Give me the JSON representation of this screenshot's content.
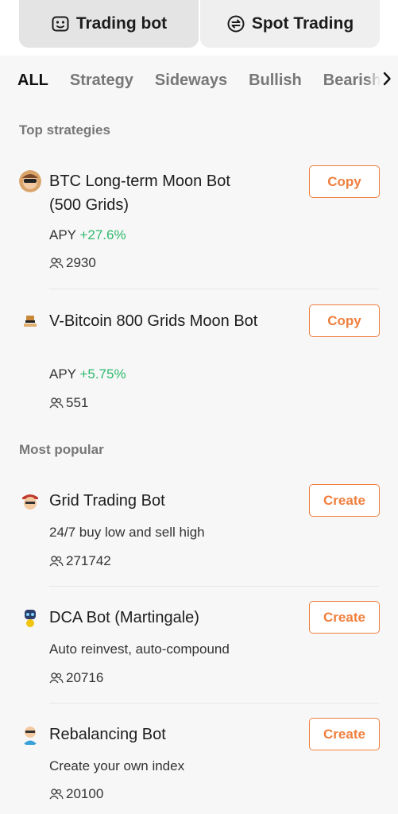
{
  "segments": [
    {
      "label": "Trading bot",
      "icon": "bot-face-icon",
      "active": true
    },
    {
      "label": "Spot Trading",
      "icon": "exchange-icon",
      "active": false
    }
  ],
  "filters": [
    "ALL",
    "Strategy",
    "Sideways",
    "Bullish",
    "Bearish"
  ],
  "filter_more_icon": "chevron-right-icon",
  "sections": {
    "top": "Top strategies",
    "popular": "Most popular"
  },
  "top_strategies": [
    {
      "name": "BTC Long-term Moon Bot (500 Grids)",
      "apy_label": "APY",
      "apy_value": "+27.6%",
      "users": "2930",
      "action": "Copy"
    },
    {
      "name": "V-Bitcoin 800 Grids Moon Bot",
      "apy_label": "APY",
      "apy_value": "+5.75%",
      "users": "551",
      "action": "Copy"
    }
  ],
  "popular": [
    {
      "name": "Grid Trading Bot",
      "desc": "24/7 buy low and sell high",
      "users": "271742",
      "action": "Create"
    },
    {
      "name": "DCA Bot (Martingale)",
      "desc": "Auto reinvest, auto-compound",
      "users": "20716",
      "action": "Create"
    },
    {
      "name": "Rebalancing Bot",
      "desc": "Create your own index",
      "users": "20100",
      "action": "Create"
    }
  ],
  "colors": {
    "accent": "#ef7f3d",
    "positive": "#2db96c",
    "muted": "#777777"
  }
}
